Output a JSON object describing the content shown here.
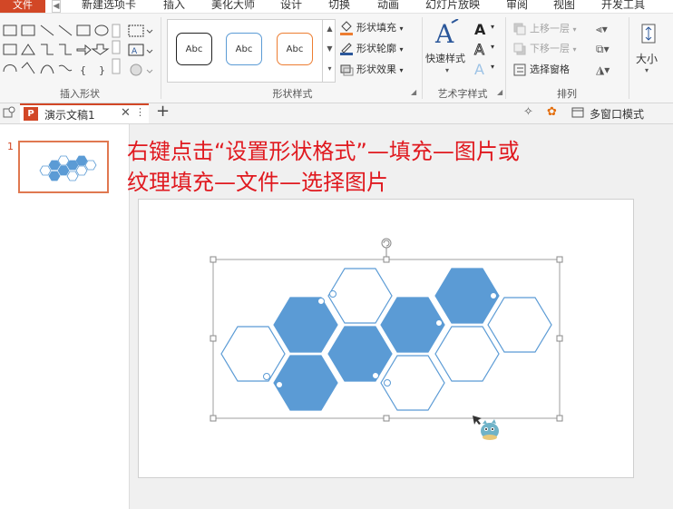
{
  "menu": {
    "file": "文件",
    "items": [
      "新建选项卡",
      "插入",
      "美化大师",
      "设计",
      "切换",
      "动画",
      "幻灯片放映",
      "审阅",
      "视图",
      "开发工具"
    ]
  },
  "ribbon": {
    "groups": {
      "insert_shapes": "插入形状",
      "shape_styles": "形状样式",
      "art_text": "艺术字样式",
      "arrange": "排列"
    },
    "style_samples": [
      "Abc",
      "Abc",
      "Abc"
    ],
    "shape_fill": "形状填充",
    "shape_outline": "形状轮廓",
    "shape_effect": "形状效果",
    "quick_styles": "快速样式",
    "bring_forward": "上移一层",
    "send_backward": "下移一层",
    "selection_pane": "选择窗格",
    "size": "大小"
  },
  "tabbar": {
    "doc_name": "演示文稿1",
    "multi_window": "多窗口模式"
  },
  "thumbnail": {
    "number": "1"
  },
  "instruction": {
    "line1": "右键点击“设置形状格式”—填充—图片或",
    "line2": "纹理填充—文件—选择图片"
  },
  "colors": {
    "accent": "#d24726",
    "hex_fill": "#5b9bd5",
    "hex_outline": "#5b9bd5",
    "instruction_text": "#e0191f"
  }
}
